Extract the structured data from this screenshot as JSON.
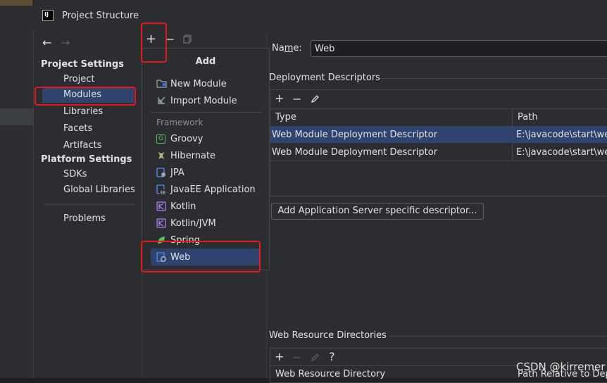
{
  "window": {
    "title": "Project Structure",
    "logo_text": "IJ"
  },
  "nav": {
    "back_glyph": "←",
    "forward_glyph": "→",
    "project_settings_header": "Project Settings",
    "project_settings_items": [
      "Project",
      "Modules",
      "Libraries",
      "Facets",
      "Artifacts"
    ],
    "platform_settings_header": "Platform Settings",
    "platform_settings_items": [
      "SDKs",
      "Global Libraries"
    ],
    "problems": "Problems",
    "selected": "Modules"
  },
  "mid_toolbar": {
    "add": "+",
    "remove": "−"
  },
  "add_popup": {
    "title": "Add",
    "items": [
      "New Module",
      "Import Module"
    ],
    "framework_label": "Framework",
    "frameworks": [
      "Groovy",
      "Hibernate",
      "JPA",
      "JavaEE Application",
      "Kotlin",
      "Kotlin/JVM",
      "Spring",
      "Web"
    ],
    "selected": "Web"
  },
  "module": {
    "name_label_prefix": "Na",
    "name_label_mnemonic": "m",
    "name_label_suffix": "e:",
    "name_value": "Web"
  },
  "deployment_descriptors": {
    "section_title": "Deployment Descriptors",
    "columns": [
      "Type",
      "Path"
    ],
    "rows": [
      {
        "type": "Web Module Deployment Descriptor",
        "path": "E:\\javacode\\start\\we"
      },
      {
        "type": "Web Module Deployment Descriptor",
        "path": "E:\\javacode\\start\\we"
      }
    ],
    "add_server_button": "Add Application Server specific descriptor..."
  },
  "web_resource_directories": {
    "section_title": "Web Resource Directories",
    "help": "?",
    "columns": [
      "Web Resource Directory",
      "Path Relative to Dep"
    ]
  },
  "watermark": "CSDN @kirremer",
  "colors": {
    "selection": "#2e436e",
    "annotation": "#e8171b",
    "background": "#2b2d30"
  }
}
